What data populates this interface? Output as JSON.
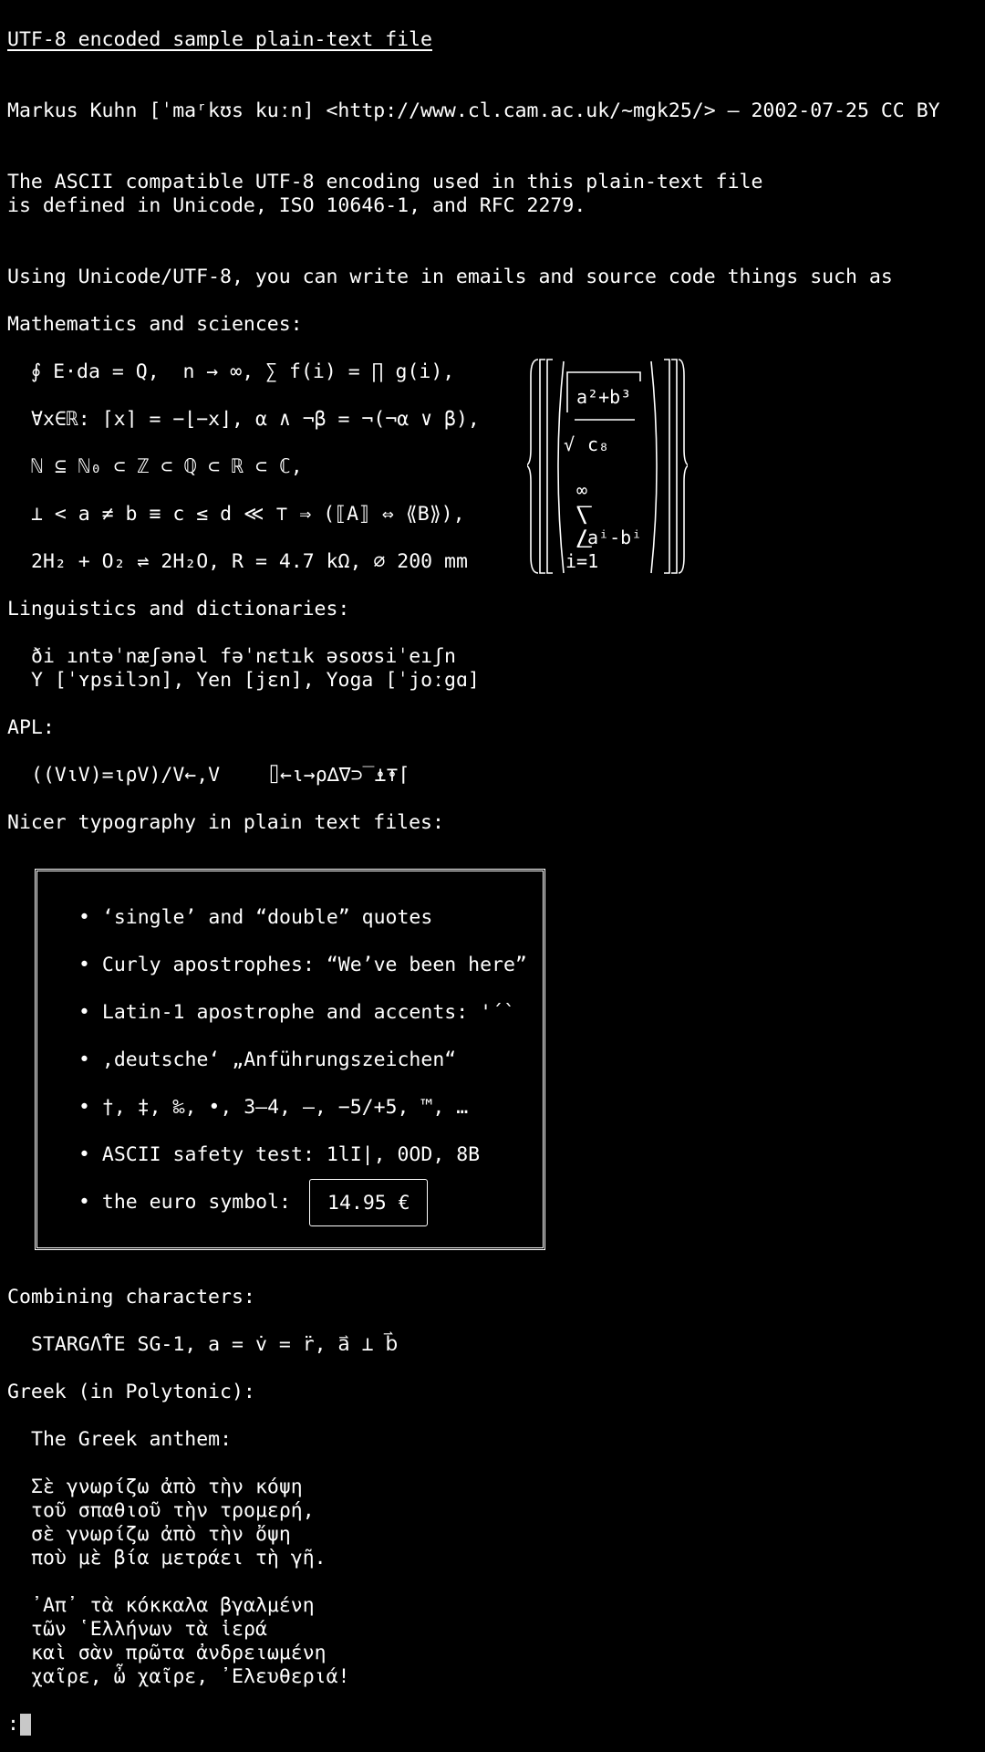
{
  "title": "UTF-8 encoded sample plain-text file",
  "author_line": "Markus Kuhn [ˈmaʳkʊs kuːn] <http://www.cl.cam.ac.uk/~mgk25/> — 2002-07-25 CC BY",
  "intro": [
    "The ASCII compatible UTF-8 encoding used in this plain-text file",
    "is defined in Unicode, ISO 10646-1, and RFC 2279."
  ],
  "using_line": "Using Unicode/UTF-8, you can write in emails and source code things such as",
  "math": {
    "heading": "Mathematics and sciences:",
    "lines": [
      "∮ E⋅da = Q,  n → ∞, ∑ f(i) = ∏ g(i),",
      "∀x∈ℝ: ⌈x⌉ = −⌊−x⌋, α ∧ ¬β = ¬(¬α ∨ β),",
      "ℕ ⊆ ℕ₀ ⊂ ℤ ⊂ ℚ ⊂ ℝ ⊂ ℂ,",
      "⊥ < a ≠ b ≡ c ≤ d ≪ ⊤ ⇒ (⟦A⟧ ⇔ ⟪B⟫),",
      "2H₂ + O₂ ⇌ 2H₂O, R = 4.7 kΩ, ⌀ 200 mm"
    ],
    "formula": {
      "numerator": "a²+b³",
      "c8": "c₈",
      "sqrt": "√",
      "infinity": "∞",
      "sum_top": "⎲",
      "sum_bottom": "⎳",
      "term": "aⁱ-bⁱ",
      "index": "i=1"
    }
  },
  "linguistics": {
    "heading": "Linguistics and dictionaries:",
    "lines": [
      "ði ıntəˈnæʃənəl fəˈnɛtık əsoʊsiˈeıʃn",
      "Y [ˈʏpsilɔn], Yen [jɛn], Yoga [ˈjoːgɑ]"
    ]
  },
  "apl": {
    "heading": "APL:",
    "line_a": "((V⍳V)=⍳⍴V)/V←,V",
    "line_b": "⌷←⍳→⍴∆∇⊃‾⍎⍕⌈"
  },
  "typography": {
    "heading": "Nicer typography in plain text files:",
    "bullets": [
      "• ‘single’ and “double” quotes",
      "• Curly apostrophes: “We’ve been here”",
      "• Latin-1 apostrophe and accents: '´`",
      "• ‚deutsche‘ „Anführungszeichen“",
      "• †, ‡, ‰, •, 3–4, —, −5/+5, ™, …",
      "• ASCII safety test: 1lI|, 0OD, 8B",
      "• the euro symbol:"
    ],
    "euro_value": "14.95 €"
  },
  "combining": {
    "heading": "Combining characters:",
    "line": "STARGΛ̊TE SG-1, a = v̇ = r̈, a⃑ ⊥ b⃑"
  },
  "greek": {
    "heading": "Greek (in Polytonic):",
    "subheading": "The Greek anthem:",
    "stanza1": [
      "Σὲ γνωρίζω ἀπὸ τὴν κόψη",
      "τοῦ σπαθιοῦ τὴν τρομερή,",
      "σὲ γνωρίζω ἀπὸ τὴν ὄψη",
      "ποὺ μὲ βία μετράει τὴ γῆ."
    ],
    "stanza2": [
      "᾿Απ᾿ τὰ κόκκαλα βγαλμένη",
      "τῶν ῾Ελλήνων τὰ ἱερά",
      "καὶ σὰν πρῶτα ἀνδρειωμένη",
      "χαῖρε, ὦ χαῖρε, ᾿Ελευθεριά!"
    ]
  },
  "prompt": ":"
}
